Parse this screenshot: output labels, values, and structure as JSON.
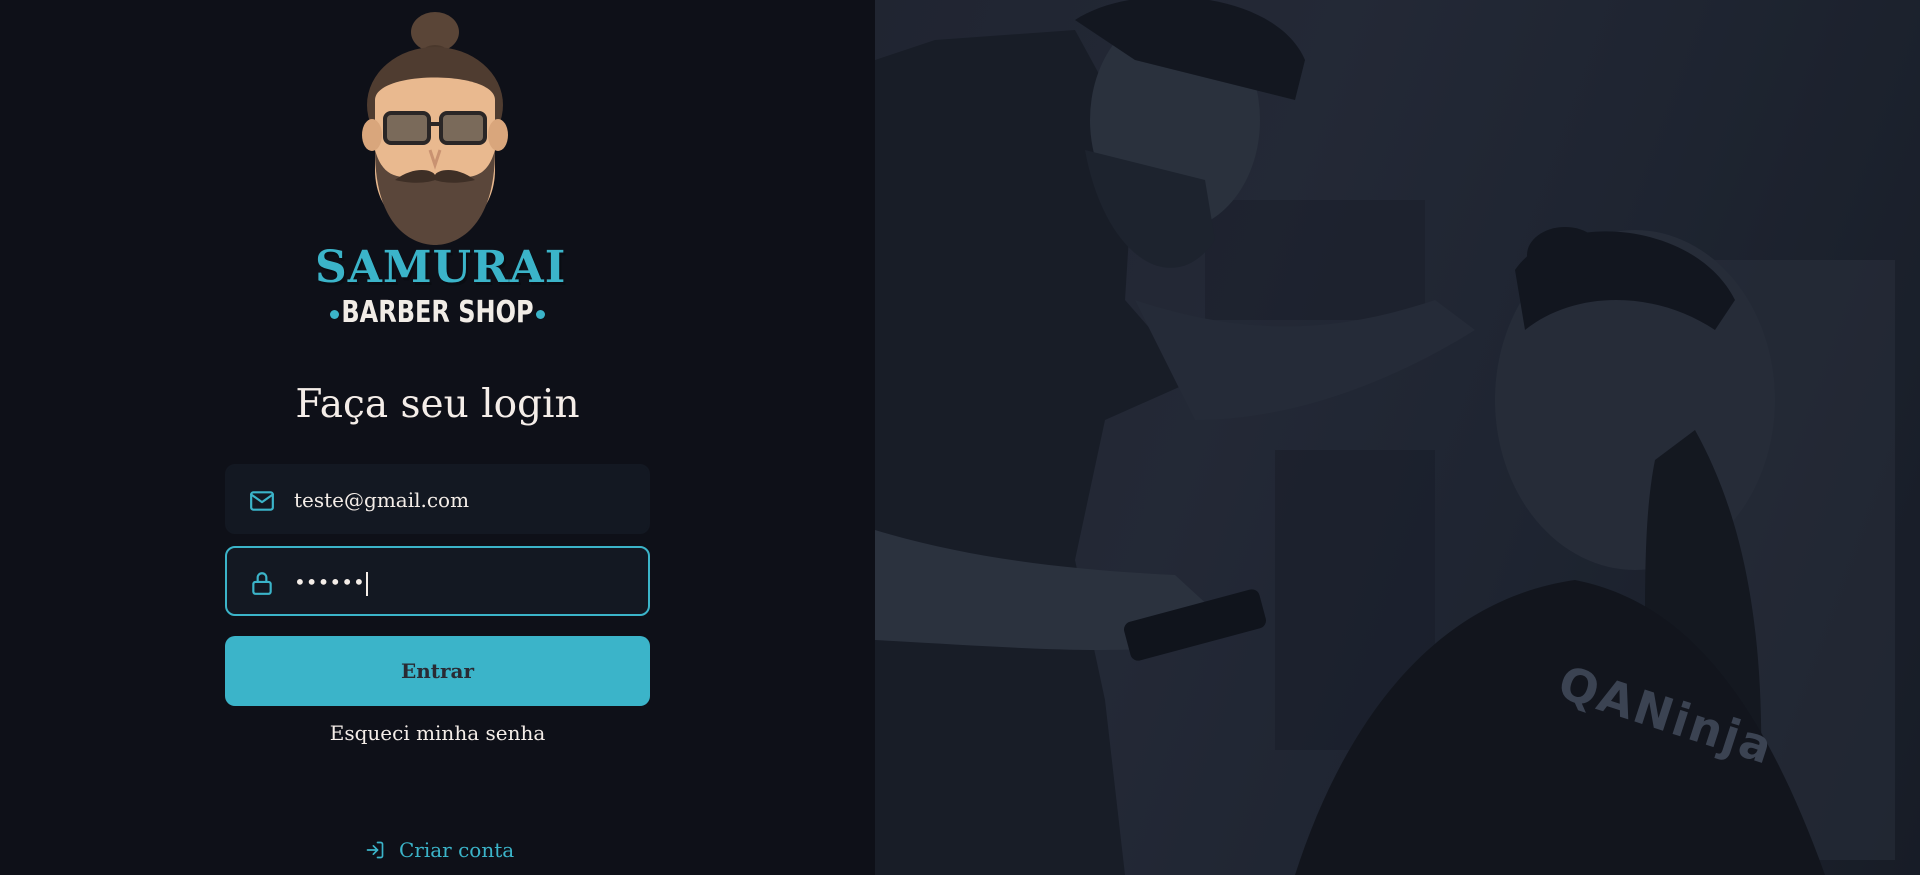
{
  "brand": {
    "name_top": "SAMURAI",
    "name_bottom": "BARBER SHOP",
    "accent": "#3bb4c9",
    "background": "#0e1018"
  },
  "login": {
    "title": "Faça seu login",
    "email": {
      "icon": "mail-icon",
      "value": "teste@gmail.com"
    },
    "password": {
      "icon": "lock-icon",
      "value": "••••••"
    },
    "submit_label": "Entrar",
    "forgot_label": "Esqueci minha senha",
    "create_account": {
      "icon": "log-in-icon",
      "label": "Criar conta"
    }
  },
  "hero": {
    "watermark": "QANinja"
  }
}
